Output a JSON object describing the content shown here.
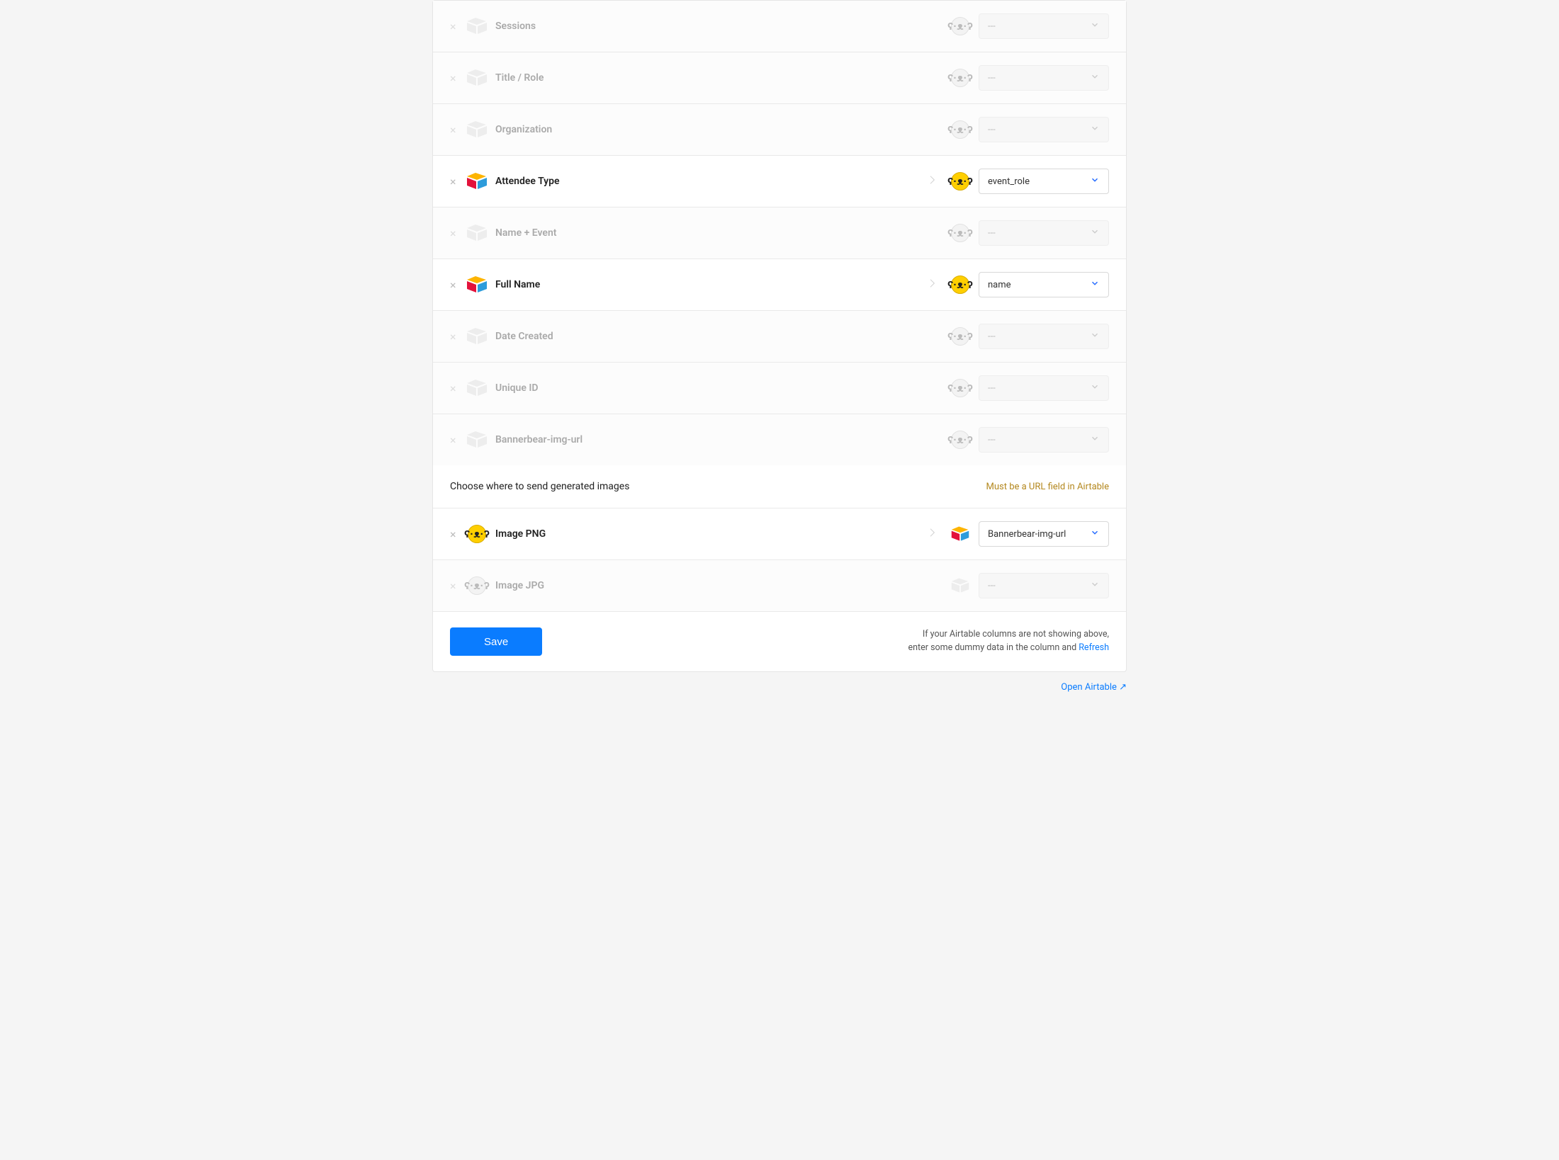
{
  "placeholder": "---",
  "rows": [
    {
      "label": "Sessions",
      "mapped": false,
      "value": ""
    },
    {
      "label": "Title / Role",
      "mapped": false,
      "value": ""
    },
    {
      "label": "Organization",
      "mapped": false,
      "value": ""
    },
    {
      "label": "Attendee Type",
      "mapped": true,
      "value": "event_role"
    },
    {
      "label": "Name + Event",
      "mapped": false,
      "value": ""
    },
    {
      "label": "Full Name",
      "mapped": true,
      "value": "name"
    },
    {
      "label": "Date Created",
      "mapped": false,
      "value": ""
    },
    {
      "label": "Unique ID",
      "mapped": false,
      "value": ""
    },
    {
      "label": "Bannerbear-img-url",
      "mapped": false,
      "value": ""
    }
  ],
  "section": {
    "title": "Choose where to send generated images",
    "hint": "Must be a URL field in Airtable"
  },
  "dest": [
    {
      "label": "Image PNG",
      "mapped": true,
      "value": "Bannerbear-img-url"
    },
    {
      "label": "Image JPG",
      "mapped": false,
      "value": ""
    }
  ],
  "footer": {
    "save": "Save",
    "helper1": "If your Airtable columns are not showing above,",
    "helper2": "enter some dummy data in the column and ",
    "refresh": "Refresh"
  },
  "open_airtable": "Open Airtable ↗"
}
